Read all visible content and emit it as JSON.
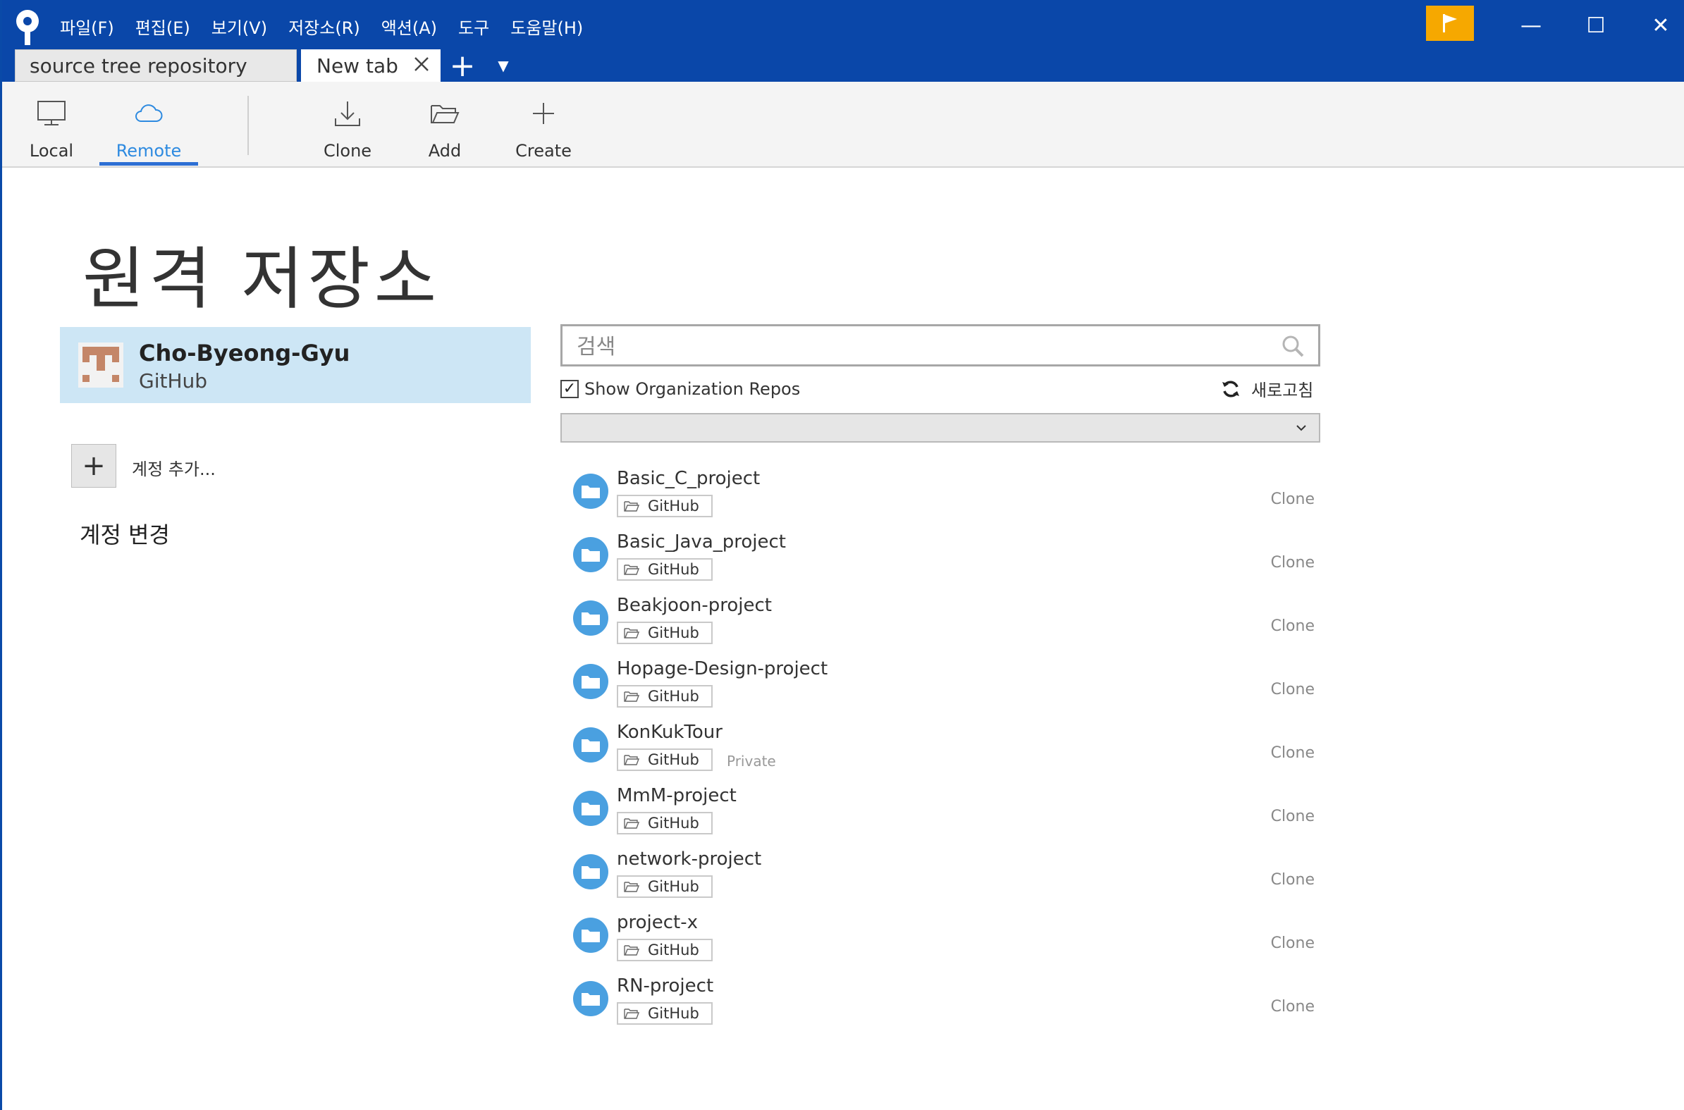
{
  "menu": [
    "파일(F)",
    "편집(E)",
    "보기(V)",
    "저장소(R)",
    "액션(A)",
    "도구",
    "도움말(H)"
  ],
  "window_controls": {
    "minimize": "—",
    "maximize": "☐",
    "close": "✕"
  },
  "tabs": [
    {
      "label": "source tree repository",
      "active": false
    },
    {
      "label": "New tab",
      "active": true
    }
  ],
  "tab_add": "+",
  "tab_dropdown": "▼",
  "toolbar": {
    "local": "Local",
    "remote": "Remote",
    "clone": "Clone",
    "add": "Add",
    "create": "Create"
  },
  "page_title": "원격 저장소",
  "account": {
    "name": "Cho-Byeong-Gyu",
    "provider": "GitHub"
  },
  "add_account": {
    "icon": "+",
    "label": "계정 추가..."
  },
  "change_account": "계정 변경",
  "search": {
    "placeholder": "검색",
    "value": ""
  },
  "show_org_repos": {
    "label": "Show Organization Repos",
    "checked": true,
    "mark": "✓"
  },
  "refresh_label": "새로고침",
  "repos": [
    {
      "name": "Basic_C_project",
      "host": "GitHub",
      "private": "",
      "action": "Clone"
    },
    {
      "name": "Basic_Java_project",
      "host": "GitHub",
      "private": "",
      "action": "Clone"
    },
    {
      "name": "Beakjoon-project",
      "host": "GitHub",
      "private": "",
      "action": "Clone"
    },
    {
      "name": "Hopage-Design-project",
      "host": "GitHub",
      "private": "",
      "action": "Clone"
    },
    {
      "name": "KonKukTour",
      "host": "GitHub",
      "private": "Private",
      "action": "Clone"
    },
    {
      "name": "MmM-project",
      "host": "GitHub",
      "private": "",
      "action": "Clone"
    },
    {
      "name": "network-project",
      "host": "GitHub",
      "private": "",
      "action": "Clone"
    },
    {
      "name": "project-x",
      "host": "GitHub",
      "private": "",
      "action": "Clone"
    },
    {
      "name": "RN-project",
      "host": "GitHub",
      "private": "",
      "action": "Clone"
    }
  ],
  "colors": {
    "titlebar": "#0a47a9",
    "flag": "#f6a800",
    "accent": "#2d8ae0",
    "selected_account": "#cde6f5",
    "repo_icon": "#4aa0e0"
  },
  "icons": {
    "app": "sourcetree-logo-icon",
    "flag": "flag-icon",
    "local": "monitor-icon",
    "remote": "cloud-icon",
    "clone": "download-icon",
    "add": "folder-open-icon",
    "create": "plus-icon",
    "search": "search-icon",
    "refresh": "refresh-icon",
    "repo": "folder-icon"
  }
}
